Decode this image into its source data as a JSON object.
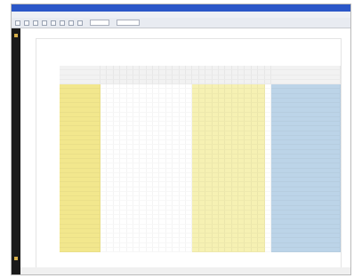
{
  "window": {
    "title": "",
    "menus": [
      "",
      "",
      "",
      "",
      "",
      ""
    ],
    "zoom": ""
  },
  "document": {
    "header_left": "",
    "header_right": "",
    "page_number": ""
  }
}
